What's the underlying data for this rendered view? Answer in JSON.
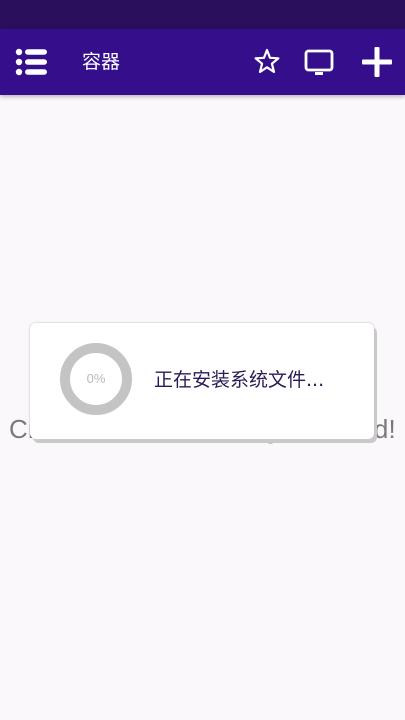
{
  "app_bar": {
    "title": "容器",
    "menu_icon": "list-menu-icon",
    "favorite_icon": "star-outline-icon",
    "display_icon": "monitor-icon",
    "add_icon": "plus-icon"
  },
  "main": {
    "empty_message": "Create a container to get started!"
  },
  "dialog": {
    "progress_text": "0%",
    "progress": 0,
    "message": "正在安装系统文件..."
  },
  "colors": {
    "status_bar": "#2a0f5c",
    "app_bar": "#350e8c",
    "background": "#fbf8fb",
    "dialog_text": "#2a1a55",
    "spinner_track": "#c4c4c4"
  }
}
